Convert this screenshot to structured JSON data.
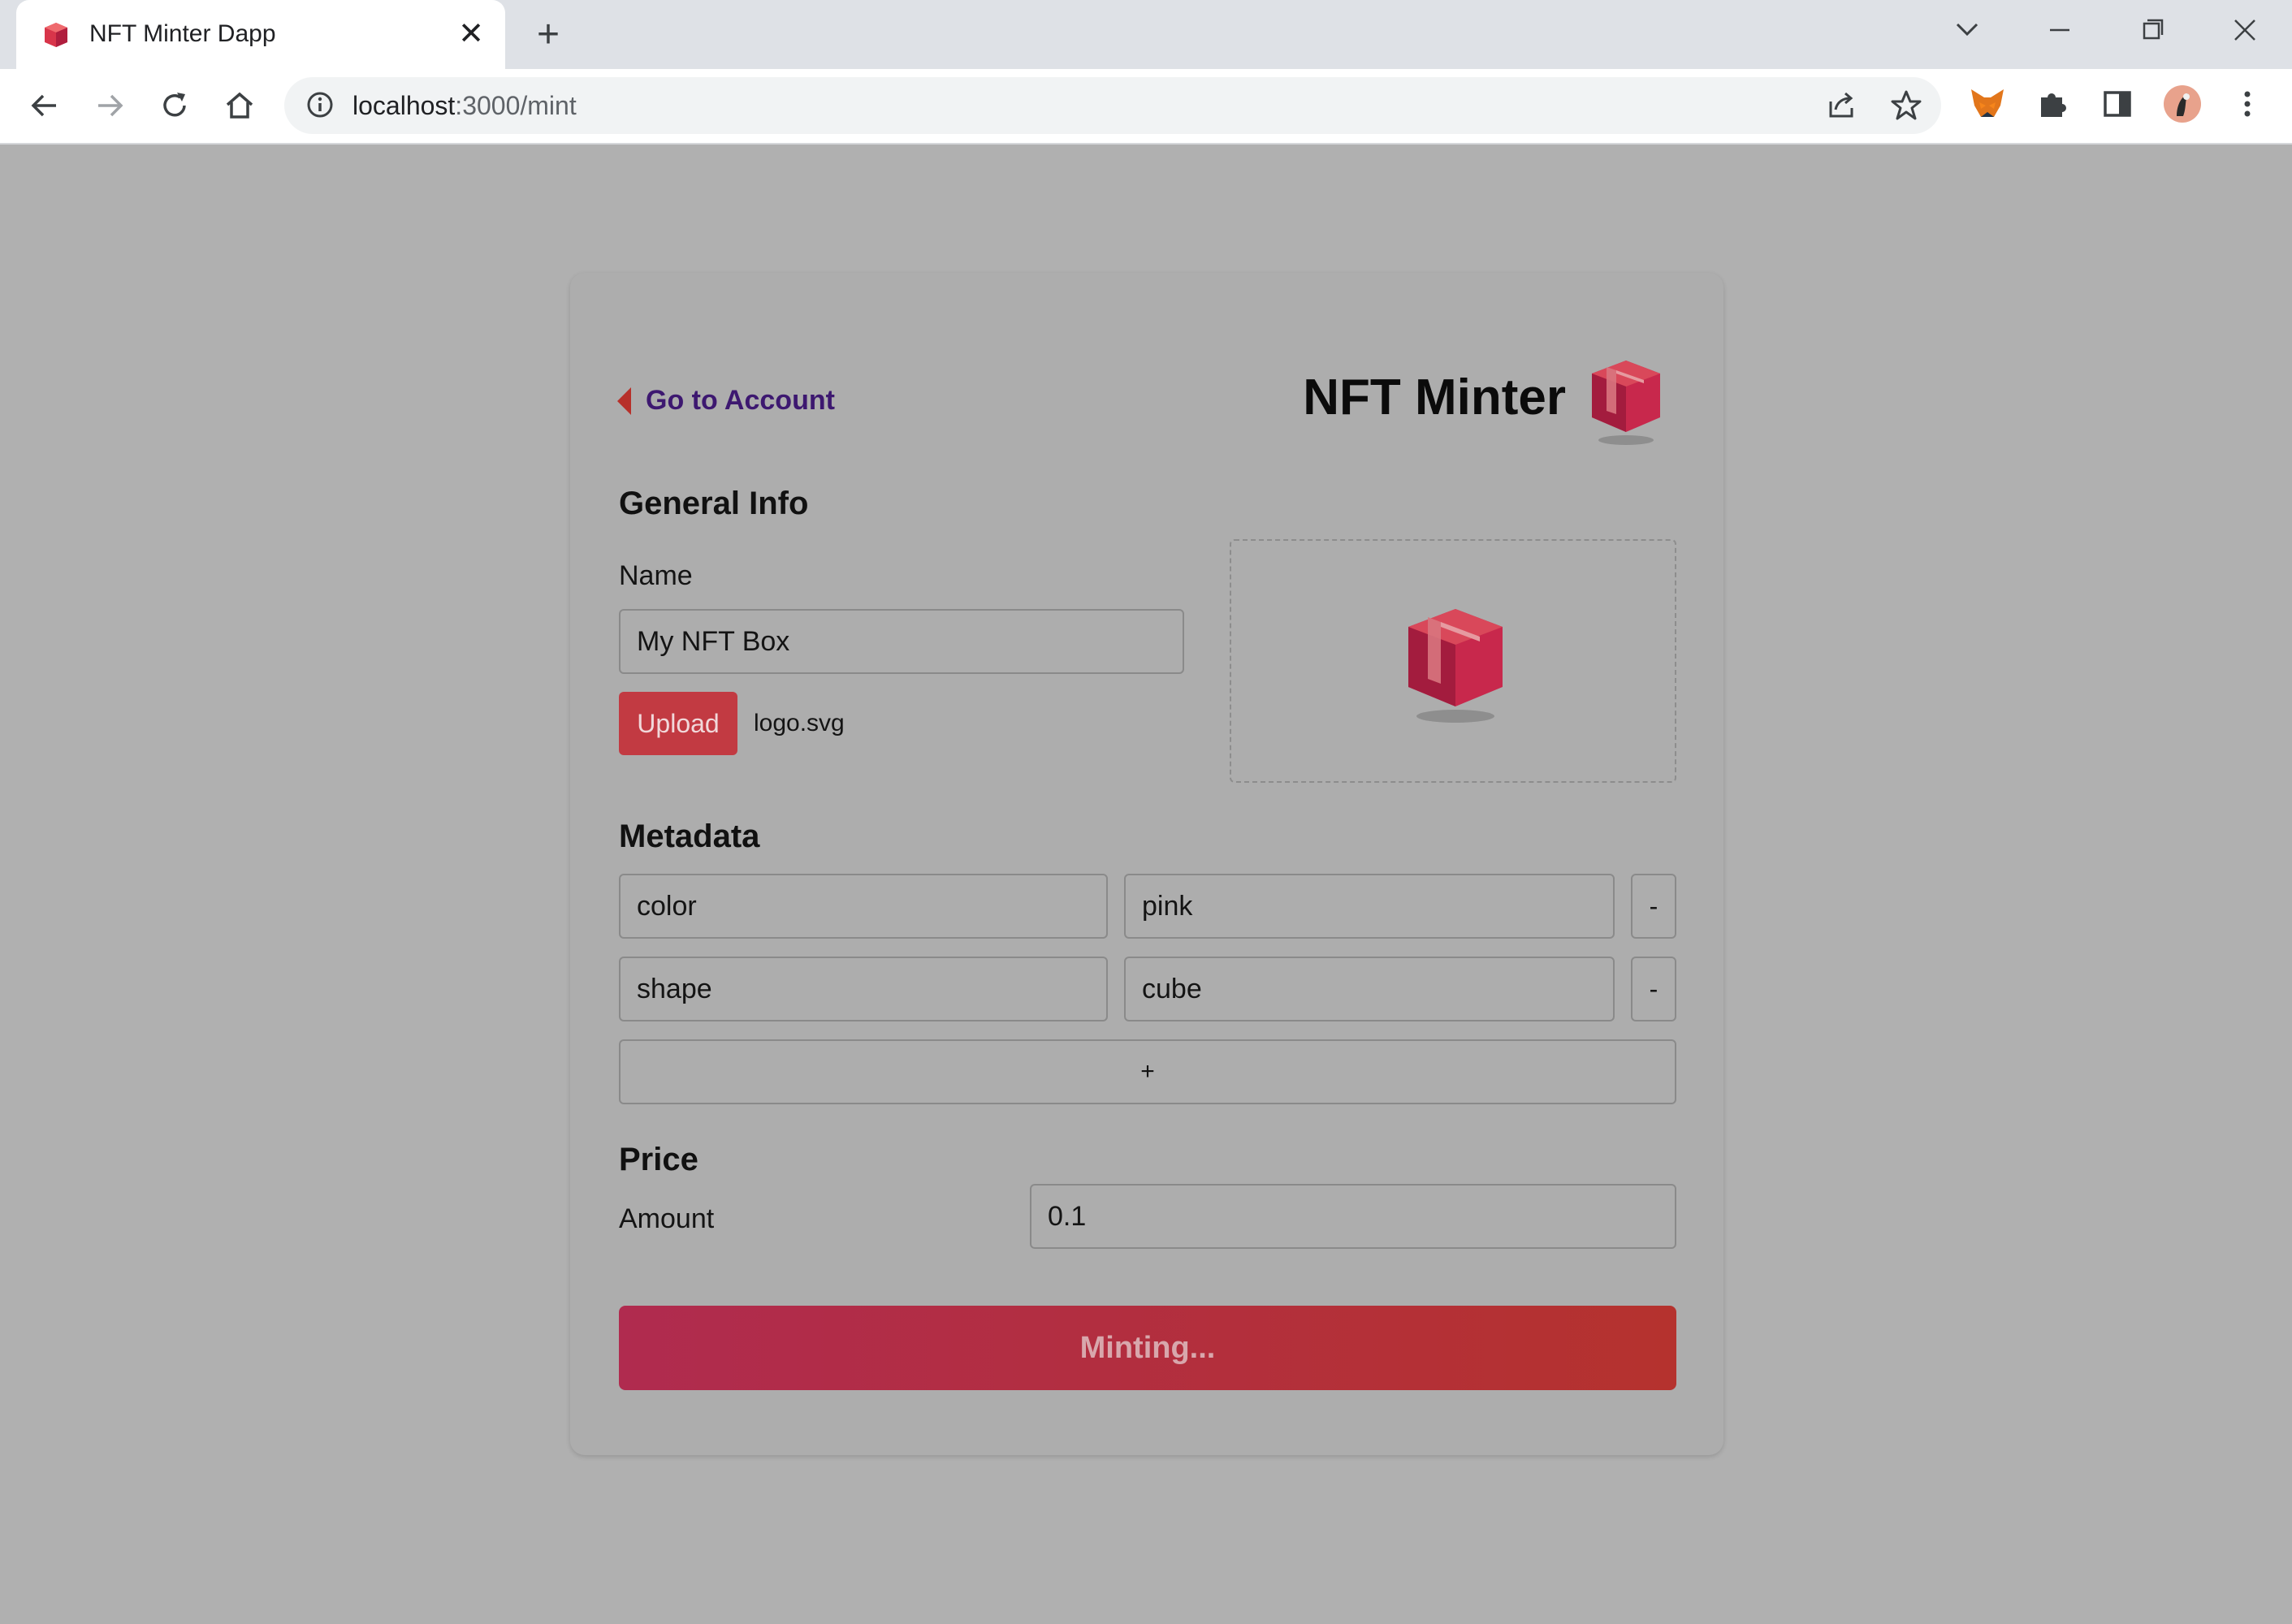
{
  "browser": {
    "tab_title": "NFT Minter Dapp",
    "url_host": "localhost",
    "url_path": ":3000/mint"
  },
  "page": {
    "back_link": "Go to Account",
    "app_title": "NFT Minter",
    "general_info": {
      "heading": "General Info",
      "name_label": "Name",
      "name_value": "My NFT Box",
      "upload_label": "Upload",
      "file_name": "logo.svg"
    },
    "metadata": {
      "heading": "Metadata",
      "rows": [
        {
          "key": "color",
          "value": "pink",
          "remove_label": "-"
        },
        {
          "key": "shape",
          "value": "cube",
          "remove_label": "-"
        }
      ],
      "add_label": "+"
    },
    "price": {
      "heading": "Price",
      "amount_label": "Amount",
      "amount_value": "0.1"
    },
    "mint_button": "Minting..."
  },
  "colors": {
    "backdrop": "#b0b0b0",
    "accent_red": "#c23a42",
    "link_purple": "#3d1870"
  },
  "icons": [
    "cube-favicon-icon",
    "close-icon",
    "plus-icon",
    "chevron-down-icon",
    "minimize-icon",
    "restore-icon",
    "window-close-icon",
    "back-arrow-icon",
    "forward-arrow-icon",
    "reload-icon",
    "home-icon",
    "info-icon",
    "share-icon",
    "star-icon",
    "metamask-fox-icon",
    "puzzle-extension-icon",
    "side-panel-icon",
    "profile-avatar",
    "kebab-menu-icon",
    "caret-left-icon",
    "nft-cube-logo"
  ]
}
